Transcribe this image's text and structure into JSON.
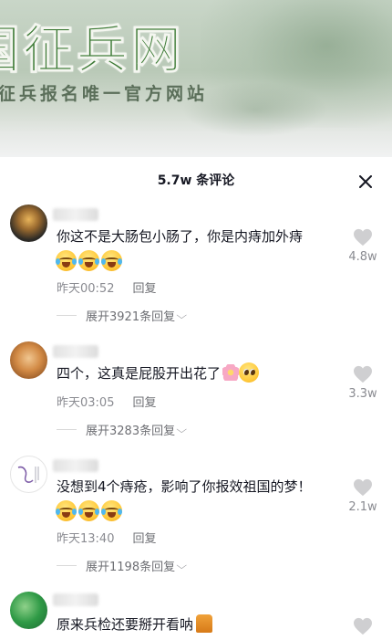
{
  "banner": {
    "logo_text": "国征兵网",
    "tagline": "征兵报名唯一官方网站"
  },
  "sheet": {
    "title": "5.7w 条评论",
    "close_icon": "close-icon"
  },
  "comments": [
    {
      "text": "你这不是大肠包小肠了，你是内痔加外痔",
      "emoji": [
        "laugh-cry-emoji",
        "laugh-cry-emoji",
        "laugh-cry-emoji"
      ],
      "time": "昨天00:52",
      "reply_label": "回复",
      "expand_label": "展开3921条回复",
      "likes": "4.8w"
    },
    {
      "text": "四个，这真是屁股开出花了",
      "emoji": [
        "flower-emoji",
        "pleading-emoji"
      ],
      "time": "昨天03:05",
      "reply_label": "回复",
      "expand_label": "展开3283条回复",
      "likes": "3.3w"
    },
    {
      "text": "没想到4个痔疮，影响了你报效祖国的梦！",
      "emoji": [
        "laugh-cry-emoji",
        "laugh-cry-emoji",
        "laugh-cry-emoji"
      ],
      "time": "昨天13:40",
      "reply_label": "回复",
      "expand_label": "展开1198条回复",
      "likes": "2.1w"
    },
    {
      "text": "原来兵检还要掰开看呐",
      "emoji": [
        "cat-sticker"
      ],
      "likes": ""
    }
  ],
  "icons": {
    "like": "heart-icon",
    "expand": "chevron-down-icon"
  }
}
